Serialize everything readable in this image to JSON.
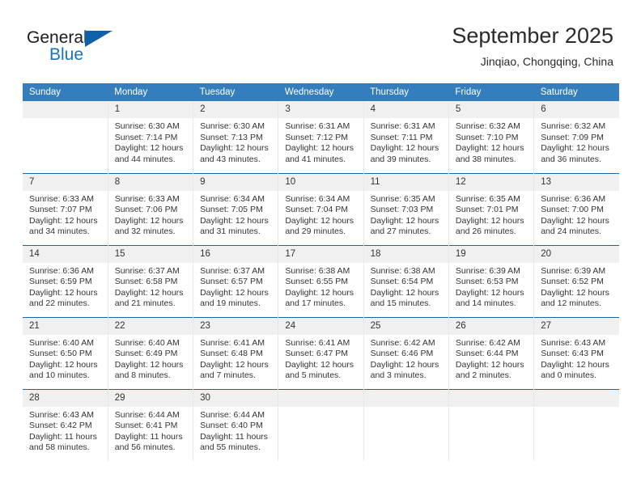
{
  "logo": {
    "word_top": "General",
    "word_bottom": "Blue",
    "triangle_color": "#1060a8",
    "blue_text_color": "#1673bd"
  },
  "header": {
    "title": "September 2025",
    "subtitle": "Jinqiao, Chongqing, China",
    "header_bg_color": "#357ebd",
    "row_rule_color": "#1a64aa",
    "daynum_bg_color": "#f0f0f0"
  },
  "weekday_headers": [
    "Sunday",
    "Monday",
    "Tuesday",
    "Wednesday",
    "Thursday",
    "Friday",
    "Saturday"
  ],
  "weeks": [
    [
      {
        "day": "",
        "sunrise": "",
        "sunset": "",
        "daylight_line1": "",
        "daylight_line2": ""
      },
      {
        "day": "1",
        "sunrise": "Sunrise: 6:30 AM",
        "sunset": "Sunset: 7:14 PM",
        "daylight_line1": "Daylight: 12 hours",
        "daylight_line2": "and 44 minutes."
      },
      {
        "day": "2",
        "sunrise": "Sunrise: 6:30 AM",
        "sunset": "Sunset: 7:13 PM",
        "daylight_line1": "Daylight: 12 hours",
        "daylight_line2": "and 43 minutes."
      },
      {
        "day": "3",
        "sunrise": "Sunrise: 6:31 AM",
        "sunset": "Sunset: 7:12 PM",
        "daylight_line1": "Daylight: 12 hours",
        "daylight_line2": "and 41 minutes."
      },
      {
        "day": "4",
        "sunrise": "Sunrise: 6:31 AM",
        "sunset": "Sunset: 7:11 PM",
        "daylight_line1": "Daylight: 12 hours",
        "daylight_line2": "and 39 minutes."
      },
      {
        "day": "5",
        "sunrise": "Sunrise: 6:32 AM",
        "sunset": "Sunset: 7:10 PM",
        "daylight_line1": "Daylight: 12 hours",
        "daylight_line2": "and 38 minutes."
      },
      {
        "day": "6",
        "sunrise": "Sunrise: 6:32 AM",
        "sunset": "Sunset: 7:09 PM",
        "daylight_line1": "Daylight: 12 hours",
        "daylight_line2": "and 36 minutes."
      }
    ],
    [
      {
        "day": "7",
        "sunrise": "Sunrise: 6:33 AM",
        "sunset": "Sunset: 7:07 PM",
        "daylight_line1": "Daylight: 12 hours",
        "daylight_line2": "and 34 minutes."
      },
      {
        "day": "8",
        "sunrise": "Sunrise: 6:33 AM",
        "sunset": "Sunset: 7:06 PM",
        "daylight_line1": "Daylight: 12 hours",
        "daylight_line2": "and 32 minutes."
      },
      {
        "day": "9",
        "sunrise": "Sunrise: 6:34 AM",
        "sunset": "Sunset: 7:05 PM",
        "daylight_line1": "Daylight: 12 hours",
        "daylight_line2": "and 31 minutes."
      },
      {
        "day": "10",
        "sunrise": "Sunrise: 6:34 AM",
        "sunset": "Sunset: 7:04 PM",
        "daylight_line1": "Daylight: 12 hours",
        "daylight_line2": "and 29 minutes."
      },
      {
        "day": "11",
        "sunrise": "Sunrise: 6:35 AM",
        "sunset": "Sunset: 7:03 PM",
        "daylight_line1": "Daylight: 12 hours",
        "daylight_line2": "and 27 minutes."
      },
      {
        "day": "12",
        "sunrise": "Sunrise: 6:35 AM",
        "sunset": "Sunset: 7:01 PM",
        "daylight_line1": "Daylight: 12 hours",
        "daylight_line2": "and 26 minutes."
      },
      {
        "day": "13",
        "sunrise": "Sunrise: 6:36 AM",
        "sunset": "Sunset: 7:00 PM",
        "daylight_line1": "Daylight: 12 hours",
        "daylight_line2": "and 24 minutes."
      }
    ],
    [
      {
        "day": "14",
        "sunrise": "Sunrise: 6:36 AM",
        "sunset": "Sunset: 6:59 PM",
        "daylight_line1": "Daylight: 12 hours",
        "daylight_line2": "and 22 minutes."
      },
      {
        "day": "15",
        "sunrise": "Sunrise: 6:37 AM",
        "sunset": "Sunset: 6:58 PM",
        "daylight_line1": "Daylight: 12 hours",
        "daylight_line2": "and 21 minutes."
      },
      {
        "day": "16",
        "sunrise": "Sunrise: 6:37 AM",
        "sunset": "Sunset: 6:57 PM",
        "daylight_line1": "Daylight: 12 hours",
        "daylight_line2": "and 19 minutes."
      },
      {
        "day": "17",
        "sunrise": "Sunrise: 6:38 AM",
        "sunset": "Sunset: 6:55 PM",
        "daylight_line1": "Daylight: 12 hours",
        "daylight_line2": "and 17 minutes."
      },
      {
        "day": "18",
        "sunrise": "Sunrise: 6:38 AM",
        "sunset": "Sunset: 6:54 PM",
        "daylight_line1": "Daylight: 12 hours",
        "daylight_line2": "and 15 minutes."
      },
      {
        "day": "19",
        "sunrise": "Sunrise: 6:39 AM",
        "sunset": "Sunset: 6:53 PM",
        "daylight_line1": "Daylight: 12 hours",
        "daylight_line2": "and 14 minutes."
      },
      {
        "day": "20",
        "sunrise": "Sunrise: 6:39 AM",
        "sunset": "Sunset: 6:52 PM",
        "daylight_line1": "Daylight: 12 hours",
        "daylight_line2": "and 12 minutes."
      }
    ],
    [
      {
        "day": "21",
        "sunrise": "Sunrise: 6:40 AM",
        "sunset": "Sunset: 6:50 PM",
        "daylight_line1": "Daylight: 12 hours",
        "daylight_line2": "and 10 minutes."
      },
      {
        "day": "22",
        "sunrise": "Sunrise: 6:40 AM",
        "sunset": "Sunset: 6:49 PM",
        "daylight_line1": "Daylight: 12 hours",
        "daylight_line2": "and 8 minutes."
      },
      {
        "day": "23",
        "sunrise": "Sunrise: 6:41 AM",
        "sunset": "Sunset: 6:48 PM",
        "daylight_line1": "Daylight: 12 hours",
        "daylight_line2": "and 7 minutes."
      },
      {
        "day": "24",
        "sunrise": "Sunrise: 6:41 AM",
        "sunset": "Sunset: 6:47 PM",
        "daylight_line1": "Daylight: 12 hours",
        "daylight_line2": "and 5 minutes."
      },
      {
        "day": "25",
        "sunrise": "Sunrise: 6:42 AM",
        "sunset": "Sunset: 6:46 PM",
        "daylight_line1": "Daylight: 12 hours",
        "daylight_line2": "and 3 minutes."
      },
      {
        "day": "26",
        "sunrise": "Sunrise: 6:42 AM",
        "sunset": "Sunset: 6:44 PM",
        "daylight_line1": "Daylight: 12 hours",
        "daylight_line2": "and 2 minutes."
      },
      {
        "day": "27",
        "sunrise": "Sunrise: 6:43 AM",
        "sunset": "Sunset: 6:43 PM",
        "daylight_line1": "Daylight: 12 hours",
        "daylight_line2": "and 0 minutes."
      }
    ],
    [
      {
        "day": "28",
        "sunrise": "Sunrise: 6:43 AM",
        "sunset": "Sunset: 6:42 PM",
        "daylight_line1": "Daylight: 11 hours",
        "daylight_line2": "and 58 minutes."
      },
      {
        "day": "29",
        "sunrise": "Sunrise: 6:44 AM",
        "sunset": "Sunset: 6:41 PM",
        "daylight_line1": "Daylight: 11 hours",
        "daylight_line2": "and 56 minutes."
      },
      {
        "day": "30",
        "sunrise": "Sunrise: 6:44 AM",
        "sunset": "Sunset: 6:40 PM",
        "daylight_line1": "Daylight: 11 hours",
        "daylight_line2": "and 55 minutes."
      },
      {
        "day": "",
        "sunrise": "",
        "sunset": "",
        "daylight_line1": "",
        "daylight_line2": ""
      },
      {
        "day": "",
        "sunrise": "",
        "sunset": "",
        "daylight_line1": "",
        "daylight_line2": ""
      },
      {
        "day": "",
        "sunrise": "",
        "sunset": "",
        "daylight_line1": "",
        "daylight_line2": ""
      },
      {
        "day": "",
        "sunrise": "",
        "sunset": "",
        "daylight_line1": "",
        "daylight_line2": ""
      }
    ]
  ]
}
